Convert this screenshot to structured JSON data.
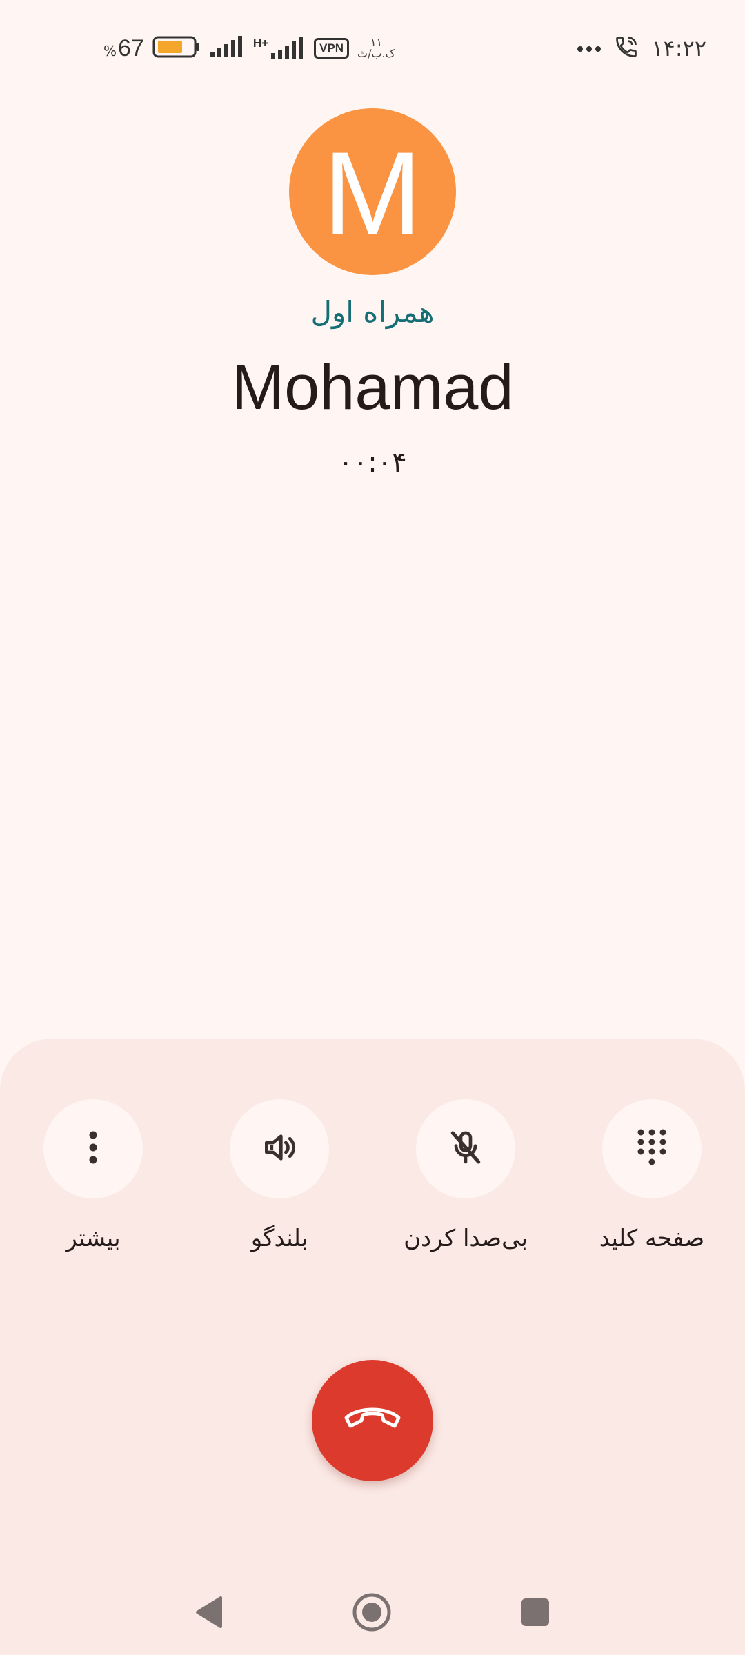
{
  "status_bar": {
    "time": "۱۴:۲۲",
    "battery_percent": "67",
    "battery_sign": "%",
    "battery_level": 0.67,
    "vpn_label": "VPN",
    "net_speed_value": "۱۱",
    "net_speed_unit": "ک.ب/ث",
    "network_type": "H+"
  },
  "call": {
    "avatar_letter": "M",
    "avatar_color": "#fa9442",
    "carrier": "همراه اول",
    "contact_name": "Mohamad",
    "duration": "۰۰:۰۴"
  },
  "controls": {
    "keypad_label": "صفحه کلید",
    "mute_label": "بی‌صدا کردن",
    "speaker_label": "بلندگو",
    "more_label": "بیشتر"
  },
  "colors": {
    "background": "#fff6f3",
    "panel": "#fbe9e5",
    "end_call": "#dc3a2c",
    "carrier_text": "#166e75"
  },
  "icons": [
    "phone-call-icon",
    "more-dots-icon",
    "signal-icon",
    "battery-icon",
    "more-vert-icon",
    "speaker-icon",
    "mic-off-icon",
    "dialpad-icon",
    "end-call-icon",
    "back-icon",
    "home-icon",
    "recents-icon"
  ]
}
